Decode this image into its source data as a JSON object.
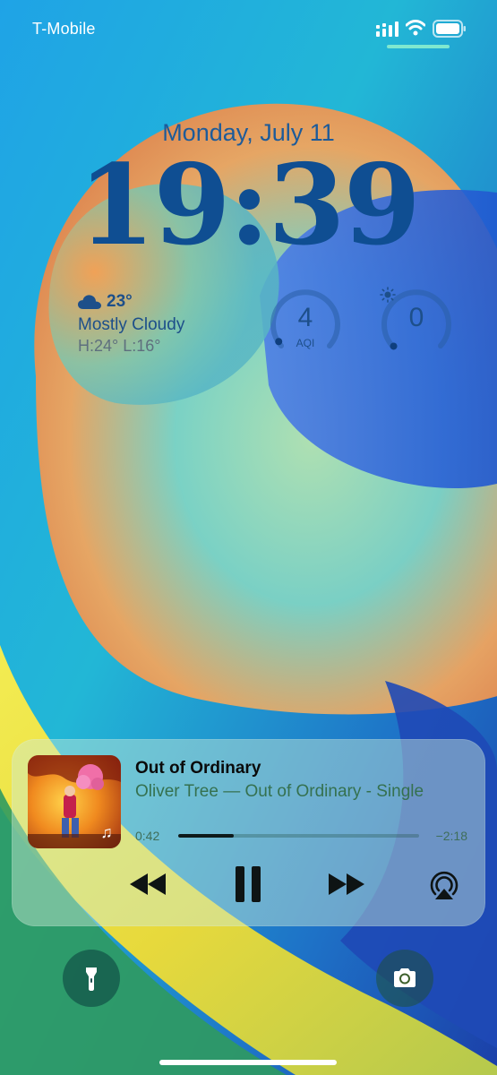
{
  "status_bar": {
    "carrier": "T-Mobile",
    "cellular_icon": "signal-bars-icon",
    "wifi_icon": "wifi-icon",
    "battery_icon": "battery-icon",
    "battery_level": 0.9
  },
  "lock_screen": {
    "date": "Monday, July 11",
    "time": "19:39"
  },
  "widgets": {
    "weather": {
      "icon": "cloud-icon",
      "temperature": "23°",
      "condition": "Mostly Cloudy",
      "high_low": "H:24° L:16°"
    },
    "aqi": {
      "value": "4",
      "label": "AQI",
      "level": 0.04
    },
    "uv": {
      "value": "0",
      "icon": "sun-icon",
      "level": 0.0
    }
  },
  "now_playing": {
    "title": "Out of Ordinary",
    "subtitle": "Oliver Tree — Out of Ordinary - Single",
    "elapsed": "0:42",
    "remaining": "−2:18",
    "progress": 0.23,
    "artwork_icon": "album-artwork",
    "app_badge_icon": "music-note-icon",
    "controls": [
      "rewind-icon",
      "pause-icon",
      "fast-forward-icon",
      "airplay-icon"
    ]
  },
  "quick_actions": {
    "left": "flashlight-icon",
    "right": "camera-icon"
  },
  "colors": {
    "accent_text": "#0f4e92",
    "player_bg": "#cdebd7",
    "progress_fill": "#0e1a1a"
  }
}
